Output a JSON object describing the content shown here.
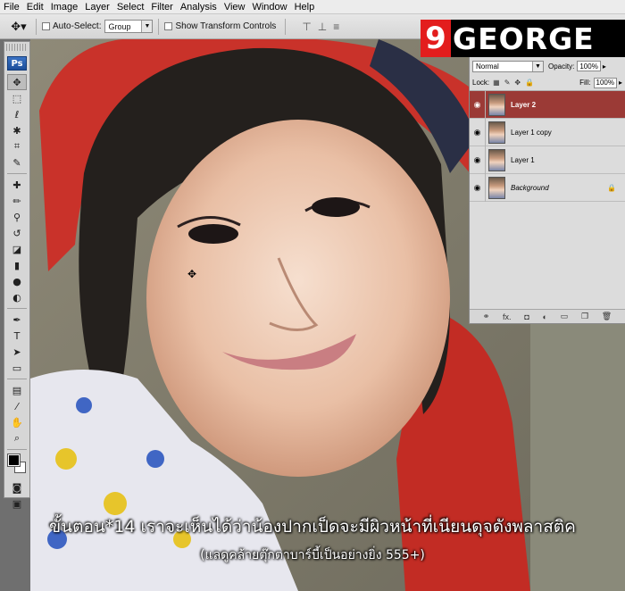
{
  "menu": [
    "File",
    "Edit",
    "Image",
    "Layer",
    "Select",
    "Filter",
    "Analysis",
    "View",
    "Window",
    "Help"
  ],
  "options_bar": {
    "auto_select_label": "Auto-Select:",
    "auto_select_value": "Group",
    "show_transform_label": "Show Transform Controls"
  },
  "logo": {
    "number": "9",
    "word": "GEORGE"
  },
  "toolbox": {
    "app_badge": "Ps",
    "type_tool": "T"
  },
  "layers_panel": {
    "blend_mode": "Normal",
    "opacity_label": "Opacity:",
    "opacity_value": "100%",
    "lock_label": "Lock:",
    "fill_label": "Fill:",
    "fill_value": "100%",
    "layers": [
      {
        "name": "Layer 2",
        "selected": true,
        "locked": false
      },
      {
        "name": "Layer 1 copy",
        "selected": false,
        "locked": false
      },
      {
        "name": "Layer 1",
        "selected": false,
        "locked": false
      },
      {
        "name": "Background",
        "selected": false,
        "locked": true
      }
    ],
    "footer_fx": "fx."
  },
  "caption": {
    "line1": "ขั้นตอน*14 เราจะเห็นได้ว่าน้องปากเป็ดจะมีผิวหน้าที่เนียนดุจดังพลาสติค",
    "line2": "(แลดูคล้ายตุ๊กตาบาร์บี้เป็นอย่างยิ่ง 555+)"
  },
  "colors": {
    "selected_layer": "#9b3a36",
    "logo_red": "#e31d1d"
  }
}
